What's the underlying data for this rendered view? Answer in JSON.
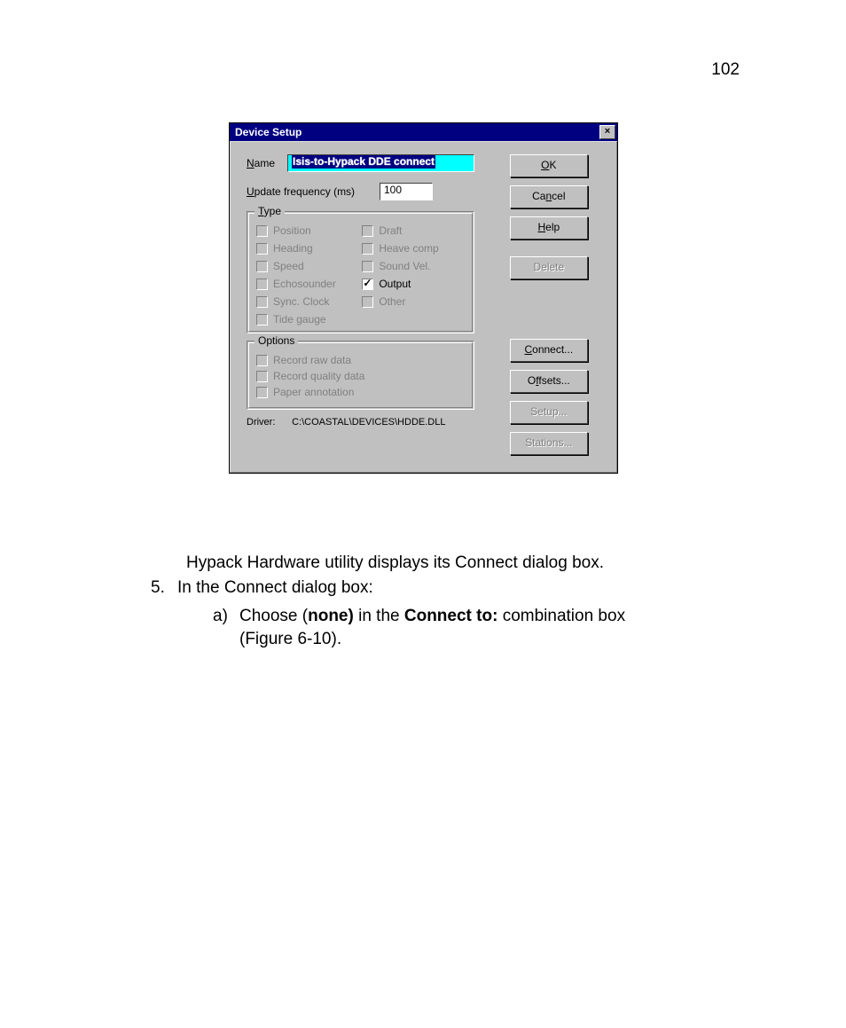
{
  "page_number": "102",
  "dialog": {
    "title": "Device Setup",
    "close_glyph": "×",
    "name_label": "Name",
    "name_value": "Isis-to-Hypack DDE connect",
    "freq_label": "Update frequency (ms)",
    "freq_value": "100",
    "type_legend": "Type",
    "type_items": [
      {
        "label": "Position",
        "checked": false,
        "enabled": false
      },
      {
        "label": "Draft",
        "checked": false,
        "enabled": false
      },
      {
        "label": "Heading",
        "checked": false,
        "enabled": false
      },
      {
        "label": "Heave comp",
        "checked": false,
        "enabled": false
      },
      {
        "label": "Speed",
        "checked": false,
        "enabled": false
      },
      {
        "label": "Sound Vel.",
        "checked": false,
        "enabled": false
      },
      {
        "label": "Echosounder",
        "checked": false,
        "enabled": false
      },
      {
        "label": "Output",
        "checked": true,
        "enabled": true
      },
      {
        "label": "Sync. Clock",
        "checked": false,
        "enabled": false
      },
      {
        "label": "Other",
        "checked": false,
        "enabled": false
      },
      {
        "label": "Tide gauge",
        "checked": false,
        "enabled": false
      }
    ],
    "options_legend": "Options",
    "options_items": [
      {
        "label": "Record raw data",
        "checked": false,
        "enabled": false
      },
      {
        "label": "Record quality data",
        "checked": false,
        "enabled": false
      },
      {
        "label": "Paper annotation",
        "checked": false,
        "enabled": false
      }
    ],
    "driver_label": "Driver:",
    "driver_path": "C:\\COASTAL\\DEVICES\\HDDE.DLL",
    "buttons": {
      "ok": "OK",
      "cancel": "Cancel",
      "help": "Help",
      "delete": "Delete",
      "connect": "Connect...",
      "offsets": "Offsets...",
      "setup": "Setup...",
      "stations": "Stations..."
    }
  },
  "body": {
    "line1": "Hypack Hardware utility displays its Connect dialog box.",
    "item5_num": "5.",
    "item5_text": "In the Connect dialog box:",
    "sub_a_letter": "a)",
    "sub_a_prefix": "Choose (",
    "sub_a_bold1": "none)",
    "sub_a_mid": " in the ",
    "sub_a_bold2": "Connect to:",
    "sub_a_suffix": " combination box (Figure 6-10)."
  }
}
